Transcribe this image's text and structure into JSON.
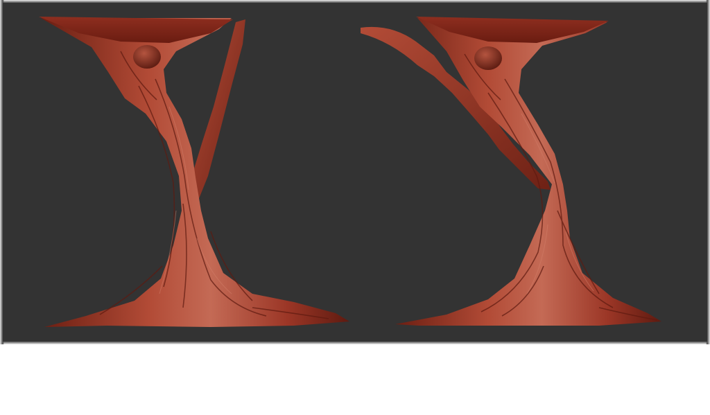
{
  "scene": {
    "subject": "sculpted-tree-model",
    "views": [
      "front-view",
      "side-view"
    ],
    "colors": {
      "background": "#333333",
      "clay": "#9b3626",
      "clay_highlight": "#c2614c",
      "clay_shadow": "#5e1a10",
      "frame": "#8a8a8a",
      "page": "#ffffff"
    }
  }
}
